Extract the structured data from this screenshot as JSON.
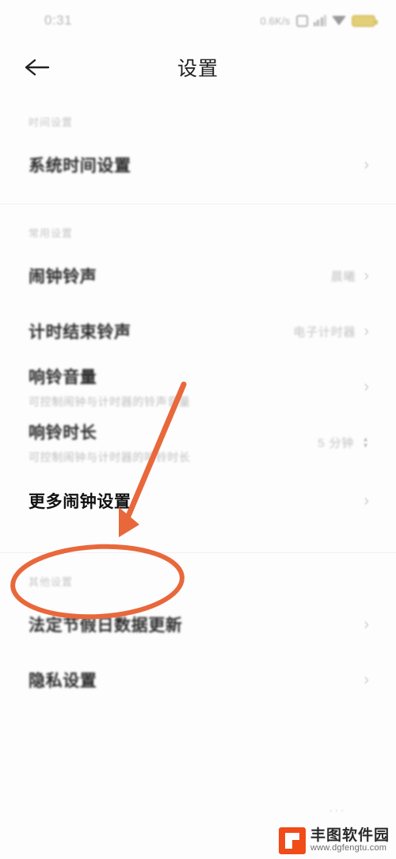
{
  "status_bar": {
    "time": "0:31",
    "network_speed": "0.6K/s",
    "icons": [
      "alarm-icon",
      "signal-icon",
      "wifi-icon",
      "battery-icon"
    ]
  },
  "header": {
    "title": "设置",
    "back_icon": "back-arrow-icon"
  },
  "sections": [
    {
      "header": "时间设置",
      "rows": [
        {
          "title": "系统时间设置",
          "sub": "",
          "value": "",
          "accessory": "chevron"
        }
      ]
    },
    {
      "header": "常用设置",
      "rows": [
        {
          "title": "闹钟铃声",
          "sub": "",
          "value": "晨曦",
          "accessory": "chevron"
        },
        {
          "title": "计时结束铃声",
          "sub": "",
          "value": "电子计时器",
          "accessory": "chevron"
        },
        {
          "title": "响铃音量",
          "sub": "可控制闹钟与计时器的铃声音量",
          "value": "",
          "accessory": "chevron"
        },
        {
          "title": "响铃时长",
          "sub": "可控制闹钟与计时器的响铃时长",
          "value": "5 分钟",
          "accessory": "stepper"
        },
        {
          "title": "更多闹钟设置",
          "sub": "",
          "value": "",
          "accessory": "chevron",
          "highlighted": true
        }
      ]
    },
    {
      "header": "其他设置",
      "rows": [
        {
          "title": "法定节假日数据更新",
          "sub": "",
          "value": "",
          "accessory": "chevron"
        },
        {
          "title": "隐私设置",
          "sub": "",
          "value": "",
          "accessory": "chevron"
        }
      ]
    }
  ],
  "annotations": {
    "accent_color": "#e8683b",
    "ellipse_target": "更多闹钟设置",
    "arrow": "points-to-more-alarm-settings"
  },
  "watermark": {
    "name": "丰图软件园",
    "url": "www.dgfengtu.com"
  }
}
